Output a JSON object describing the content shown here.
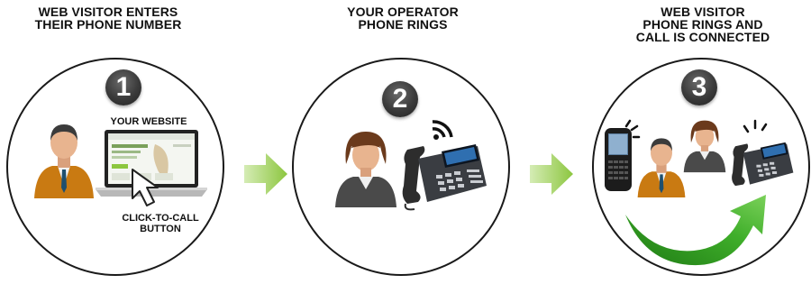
{
  "steps": [
    {
      "title": "WEB VISITOR ENTERS\nTHEIR PHONE NUMBER",
      "number": "1",
      "website_label": "YOUR WEBSITE",
      "button_label": "CLICK-TO-CALL\nBUTTON"
    },
    {
      "title": "YOUR OPERATOR\nPHONE RINGS",
      "number": "2"
    },
    {
      "title": "WEB VISITOR\nPHONE RINGS AND\nCALL IS CONNECTED",
      "number": "3"
    }
  ],
  "icons": {
    "visitor": "visitor-man-icon",
    "laptop": "laptop-icon",
    "operator": "operator-woman-icon",
    "desk_phone": "desk-phone-icon",
    "signal": "wifi-signal-icon",
    "smartphone": "smartphone-icon",
    "arrow": "next-step-arrow-icon",
    "connect": "curved-connect-arrow-icon"
  },
  "colors": {
    "arrow_green": "#8cc63f",
    "connect_green": "#2e9a1f",
    "skin": "#e8b48f",
    "hair": "#6b3a1c",
    "man_jacket": "#c97a12",
    "woman_jacket": "#4a4a4a"
  }
}
